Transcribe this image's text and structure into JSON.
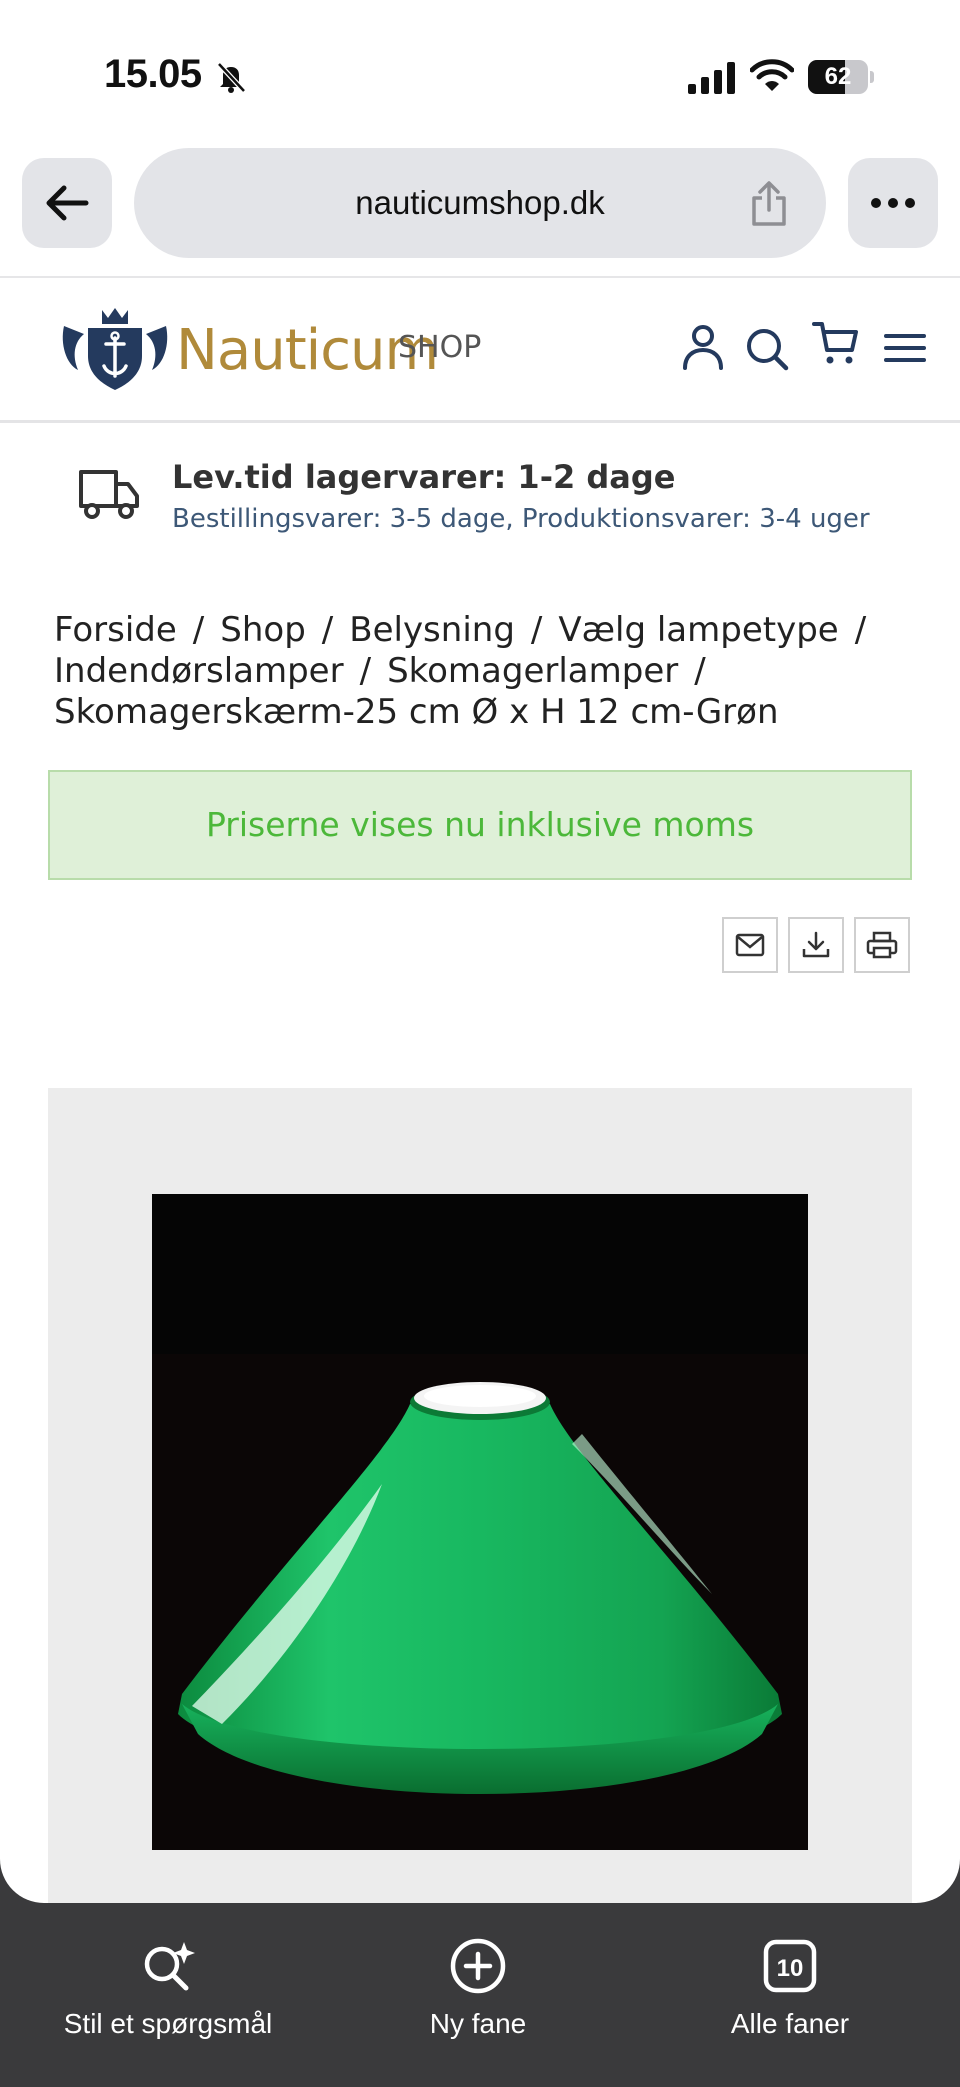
{
  "status_bar": {
    "time": "15.05",
    "battery_level": "62",
    "battery_fraction": 0.62,
    "icons": [
      "bell-slash-icon",
      "cellular-signal-icon",
      "wifi-icon",
      "battery-icon"
    ]
  },
  "browser": {
    "url": "nauticumshop.dk",
    "back_icon": "arrow-left-icon",
    "share_icon": "share-icon",
    "more_icon": "ellipsis-icon"
  },
  "site_header": {
    "logo_name": "Nauticum",
    "logo_suffix": "SHOP",
    "brand_color": "#b08a3a",
    "crest_color": "#243a5e",
    "icons": [
      "user-icon",
      "search-icon",
      "cart-icon",
      "menu-icon"
    ]
  },
  "delivery": {
    "title": "Lev.tid lagervarer: 1-2 dage",
    "subtitle": "Bestillingsvarer: 3-5 dage, Produktionsvarer: 3-4 uger"
  },
  "breadcrumb": {
    "items": [
      "Forside",
      "Shop",
      "Belysning",
      "Vælg lampetype",
      "Indendørslamper",
      "Skomagerlamper",
      "Skomagerskærm-25 cm Ø x H 12 cm-Grøn"
    ],
    "separator": "/"
  },
  "notice": {
    "text": "Priserne vises nu inklusive moms",
    "background": "#dff0d8",
    "text_color": "#4cb83a"
  },
  "tools": [
    "mail-icon",
    "download-icon",
    "print-icon"
  ],
  "product": {
    "image": "green-glass-lamp-shade"
  },
  "bottom_toolbar": {
    "ask_label": "Stil et spørgsmål",
    "new_tab_label": "Ny fane",
    "all_tabs_label": "Alle faner",
    "tab_count": "10"
  }
}
